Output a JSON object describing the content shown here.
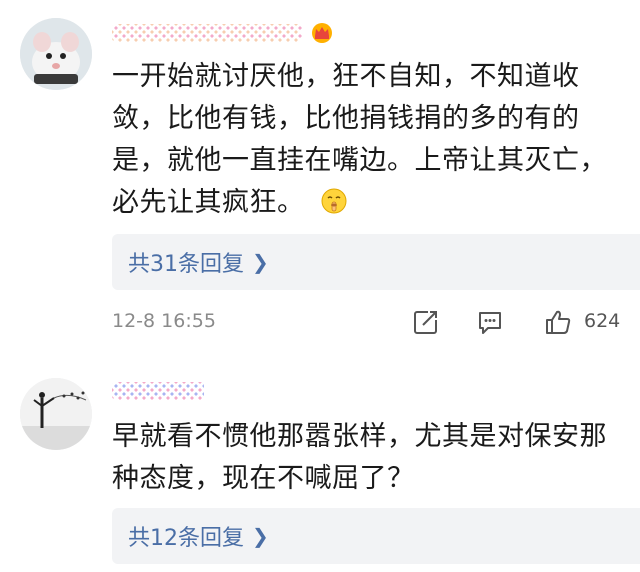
{
  "comments": [
    {
      "text": "一开始就讨厌他，狂不自知，不知道收敛，比他有钱，比他捐钱捐的多的有的是，就他一直挂在嘴边。上帝让其灭亡，必先让其疯狂。",
      "emoji": "shush-emoji",
      "reply_label": "共31条回复",
      "time": "12-8 16:55",
      "likes": "624"
    },
    {
      "text": "早就看不惯他那嚣张样，尤其是对保安那种态度，现在不喊屈了？",
      "reply_label": "共12条回复"
    }
  ],
  "colors": {
    "link": "#4a6ea6",
    "reply_bg": "#f2f3f5",
    "meta": "#8a8a8a"
  }
}
